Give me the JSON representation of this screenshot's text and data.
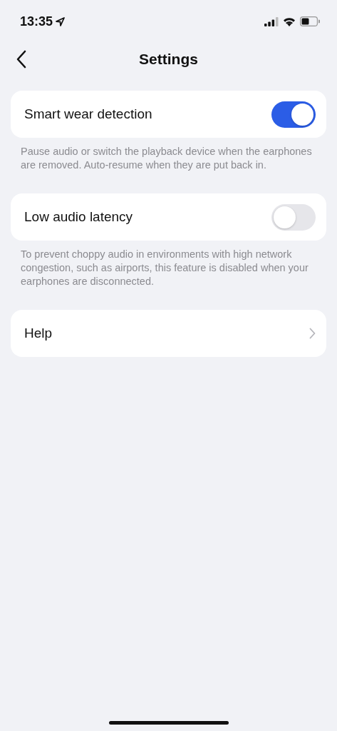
{
  "status_bar": {
    "time": "13:35"
  },
  "header": {
    "title": "Settings"
  },
  "sections": [
    {
      "kind": "toggle",
      "label": "Smart wear detection",
      "on": true,
      "description": "Pause audio or switch the playback device when the earphones are removed. Auto-resume when they are put back in."
    },
    {
      "kind": "toggle",
      "label": "Low audio latency",
      "on": false,
      "description": "To prevent choppy audio in environments with high network congestion, such as airports, this feature is disabled when your earphones are disconnected."
    },
    {
      "kind": "link",
      "label": "Help"
    }
  ]
}
